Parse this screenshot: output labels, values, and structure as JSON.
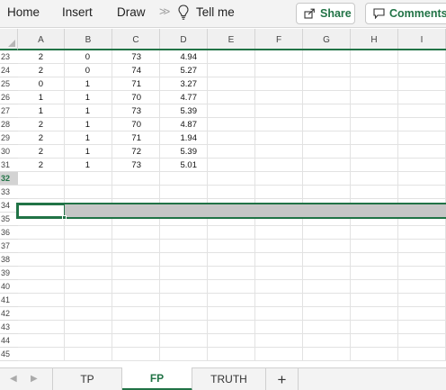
{
  "ribbon": {
    "tabs": [
      "Home",
      "Insert",
      "Draw"
    ],
    "overflow_glyph": ">>",
    "tell_me": "Tell me",
    "share_label": "Share",
    "comments_label": "Comments",
    "accent": "#217346"
  },
  "grid": {
    "columns": [
      "A",
      "B",
      "C",
      "D",
      "E",
      "F",
      "G",
      "H",
      "I"
    ],
    "rows": [
      "23",
      "24",
      "25",
      "26",
      "27",
      "28",
      "29",
      "30",
      "31",
      "32",
      "33",
      "34",
      "35",
      "36",
      "37",
      "38",
      "39",
      "40",
      "41",
      "42",
      "43",
      "44",
      "45"
    ],
    "selected_row": "32",
    "data": [
      [
        "2",
        "0",
        "73",
        "4.94"
      ],
      [
        "2",
        "0",
        "74",
        "5.27"
      ],
      [
        "0",
        "1",
        "71",
        "3.27"
      ],
      [
        "1",
        "1",
        "70",
        "4.77"
      ],
      [
        "1",
        "1",
        "73",
        "5.39"
      ],
      [
        "2",
        "1",
        "70",
        "4.87"
      ],
      [
        "2",
        "1",
        "71",
        "1.94"
      ],
      [
        "2",
        "1",
        "72",
        "5.39"
      ],
      [
        "2",
        "1",
        "73",
        "5.01"
      ]
    ]
  },
  "sheets": {
    "tabs": [
      "TP",
      "FP",
      "TRUTH"
    ],
    "active": "FP",
    "add_label": "+"
  }
}
